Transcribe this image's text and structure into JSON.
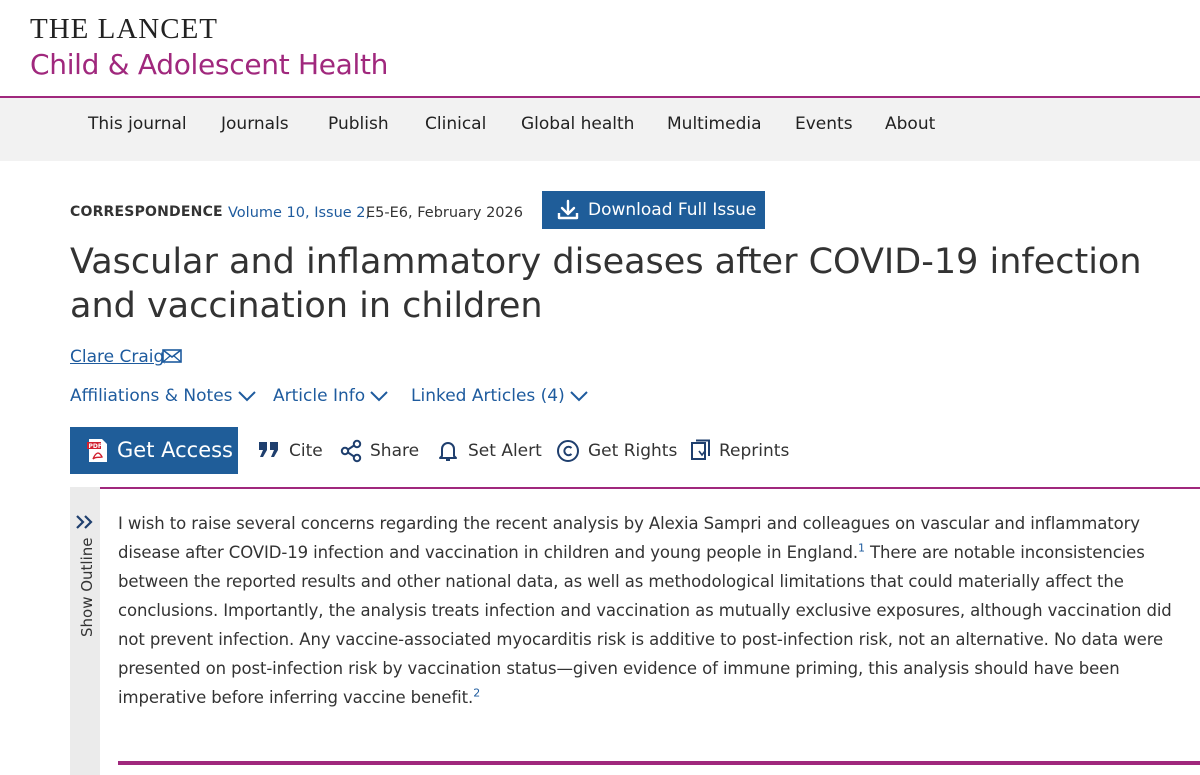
{
  "journal": {
    "name_top": "THE LANCET",
    "name_bottom": "Child & Adolescent Health"
  },
  "nav": {
    "items": [
      "This journal",
      "Journals",
      "Publish",
      "Clinical",
      "Global health",
      "Multimedia",
      "Events",
      "About"
    ]
  },
  "article": {
    "type": "CORRESPONDENCE",
    "separator": "·",
    "volume": "Volume 10, Issue 2,",
    "pages_date": "E5-E6, February 2026",
    "download_label": "Download Full Issue",
    "title": "Vascular and inflammatory diseases after COVID-19 infection and vaccination in children",
    "author": "Clare Craig",
    "disclosures": [
      "Affiliations & Notes",
      "Article Info",
      "Linked Articles (4)"
    ]
  },
  "actions": {
    "get_access": "Get Access",
    "cite": "Cite",
    "share": "Share",
    "set_alert": "Set Alert",
    "get_rights": "Get Rights",
    "reprints": "Reprints"
  },
  "outline": {
    "label": "Show Outline"
  },
  "body": {
    "part1": "I wish to raise several concerns regarding the recent analysis by Alexia Sampri and colleagues on vascular and inflammatory disease after COVID-19 infection and vaccination in children and young people in England.",
    "ref1": "1",
    "part2": " There are notable inconsistencies between the reported results and other national data, as well as methodological limitations that could materially affect the conclusions. Importantly, the analysis treats infection and vaccination as mutually exclusive exposures, although vaccination did not prevent infection. Any vaccine-associated myocarditis risk is additive to post-infection risk, not an alternative. No data were presented on post-infection risk by vaccination status—given evidence of immune priming, this analysis should have been imperative before inferring vaccine benefit.",
    "ref2": "2"
  },
  "colors": {
    "brand_magenta": "#a0287d",
    "primary_blue": "#1f5d99",
    "link_blue": "#1e5b9e",
    "nav_bg": "#f2f2f2"
  }
}
